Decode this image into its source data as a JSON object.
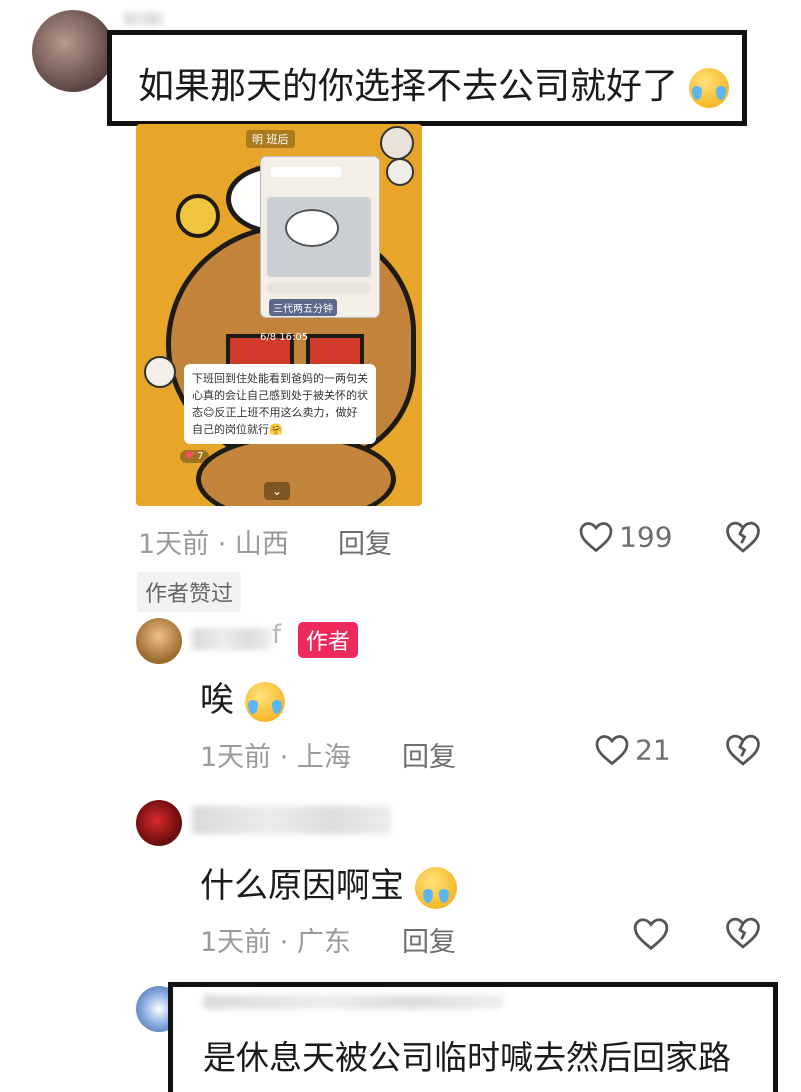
{
  "comment1": {
    "text": "如果那天的你选择不去公司就好了",
    "meta": "1天前 · 山西",
    "reply": "回复",
    "likes": "199",
    "badge": "作者赞过",
    "image": {
      "header": "明 班后",
      "inner_caption": "三代两五分钟",
      "date": "6/8 16:05",
      "message": "下班回到住处能看到爸妈的一两句关心真的会让自己感到处于被关怀的状态😊反正上班不用这么卖力，做好自己的岗位就行🤗",
      "reaction": "7"
    }
  },
  "reply1": {
    "name_suffix": "f",
    "author_tag": "作者",
    "text": "唉",
    "meta": "1天前 · 上海",
    "reply": "回复",
    "likes": "21"
  },
  "reply2": {
    "text": "什么原因啊宝",
    "meta": "1天前 · 广东",
    "reply": "回复"
  },
  "reply3": {
    "text": "是休息天被公司临时喊去然后回家路"
  },
  "colors": {
    "author_tag": "#ee2a5b",
    "meta": "#9a9a9a",
    "image_bg": "#e7a52a"
  },
  "icons": {
    "like": "heart-outline-icon",
    "dislike": "broken-heart-icon",
    "emoji_cry": "loudly-crying-emoji",
    "emoji_plead": "pleading-tears-emoji"
  }
}
